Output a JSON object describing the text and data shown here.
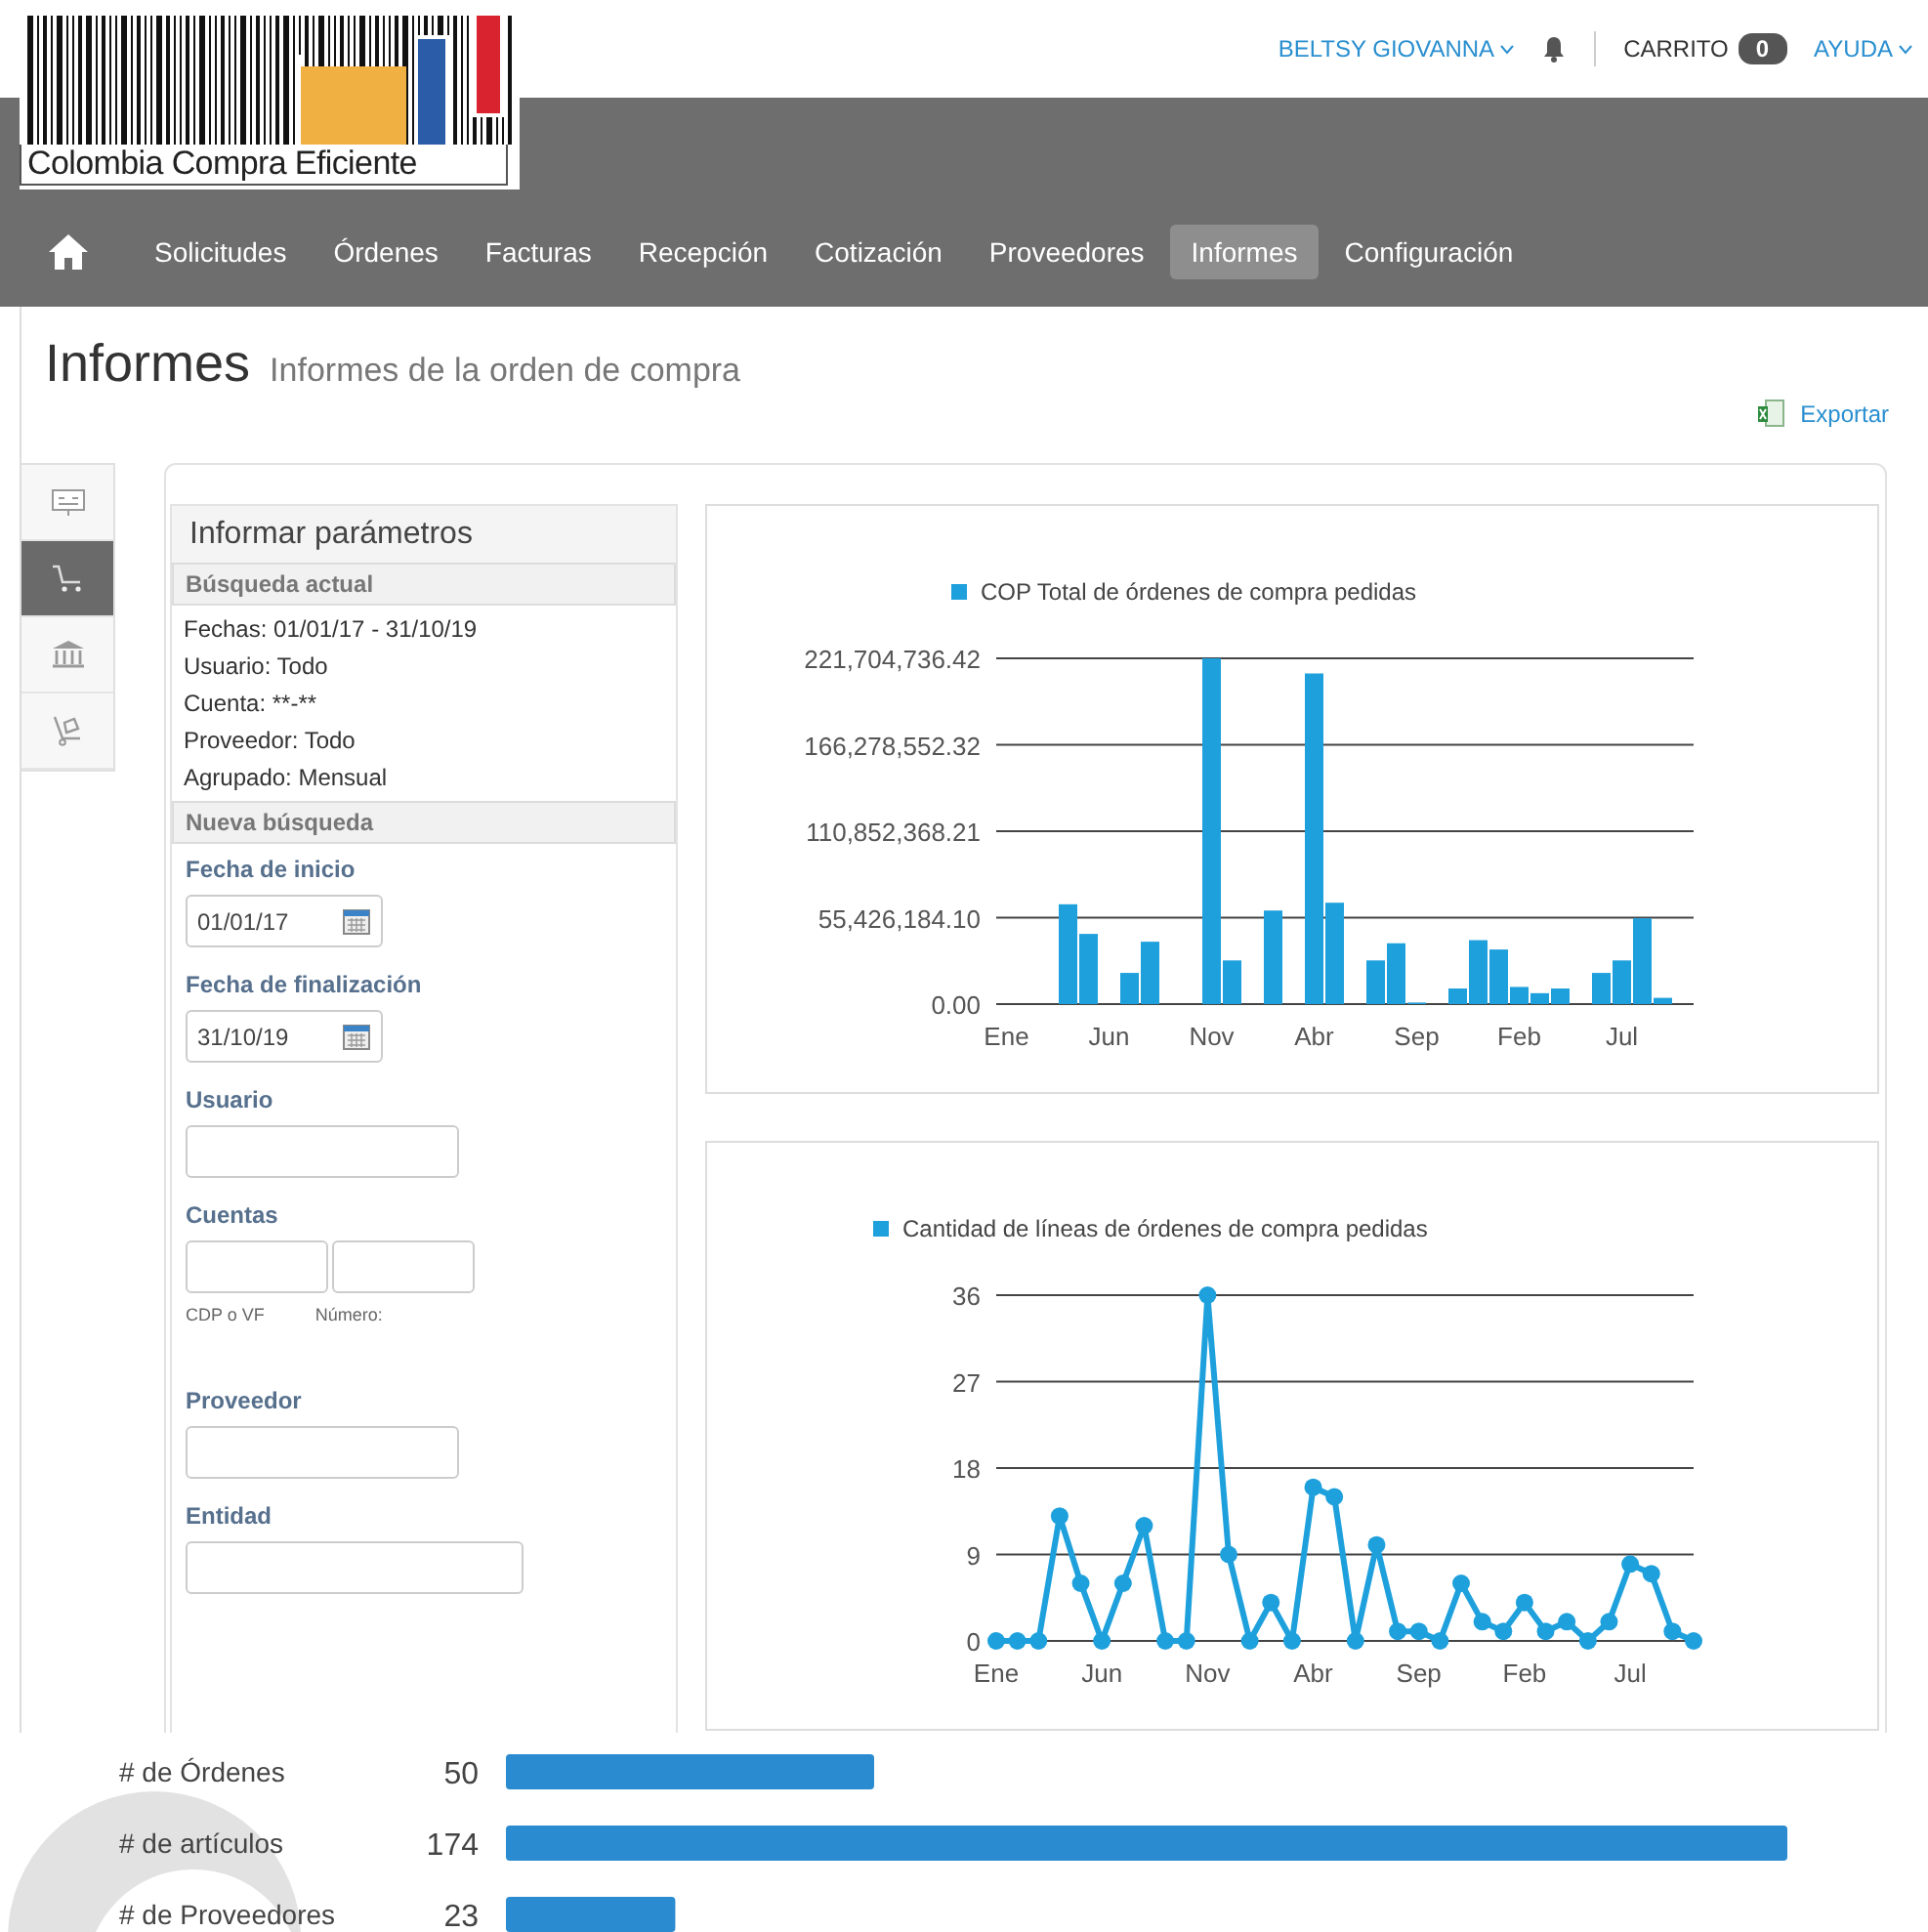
{
  "header": {
    "user": "BELTSY GIOVANNA",
    "cart_label": "CARRITO",
    "cart_count": "0",
    "help": "AYUDA"
  },
  "logo": {
    "text": "Colombia Compra Eficiente"
  },
  "nav": [
    {
      "label": "Solicitudes",
      "selected": false
    },
    {
      "label": "Órdenes",
      "selected": false
    },
    {
      "label": "Facturas",
      "selected": false
    },
    {
      "label": "Recepción",
      "selected": false
    },
    {
      "label": "Cotización",
      "selected": false
    },
    {
      "label": "Proveedores",
      "selected": false
    },
    {
      "label": "Informes",
      "selected": true
    },
    {
      "label": "Configuración",
      "selected": false
    }
  ],
  "page": {
    "title": "Informes",
    "subtitle": "Informes de la orden de compra",
    "export": "Exportar"
  },
  "side_tabs": [
    {
      "kind": "board",
      "selected": false
    },
    {
      "kind": "cart",
      "selected": true
    },
    {
      "kind": "bank",
      "selected": false
    },
    {
      "kind": "trolley",
      "selected": false
    }
  ],
  "params": {
    "title": "Informar parámetros",
    "current_heading": "Búsqueda actual",
    "current": [
      "Fechas: 01/01/17 - 31/10/19",
      "Usuario: Todo",
      "Cuenta: **-**",
      "Proveedor: Todo",
      "Agrupado: Mensual"
    ],
    "new_heading": "Nueva búsqueda",
    "fields": [
      {
        "kind": "date",
        "label": "Fecha de inicio",
        "value": "01/01/17"
      },
      {
        "kind": "date",
        "label": "Fecha de finalización",
        "value": "31/10/19"
      },
      {
        "kind": "text",
        "label": "Usuario"
      },
      {
        "kind": "pair",
        "label": "Cuentas",
        "captions": [
          "CDP o VF",
          "Número:"
        ]
      },
      {
        "kind": "text",
        "label": "Proveedor"
      },
      {
        "kind": "wide",
        "label": "Entidad"
      }
    ]
  },
  "charts": [
    {
      "chart_data": {
        "type": "bar",
        "categories": [
          "Ene",
          null,
          null,
          null,
          null,
          "Jun",
          null,
          null,
          null,
          null,
          "Nov",
          null,
          null,
          null,
          null,
          "Abr",
          null,
          null,
          null,
          null,
          "Sep",
          null,
          null,
          null,
          null,
          "Feb",
          null,
          null,
          null,
          null,
          "Jul",
          null,
          null,
          null
        ],
        "series": [
          {
            "name": "COP Total de órdenes de compra pedidas",
            "color": "#1ea0dc",
            "values": [
              0,
              0,
              0,
              64000000,
              45000000,
              0,
              20000000,
              40000000,
              0,
              0,
              221700000,
              28000000,
              0,
              60000000,
              0,
              212000000,
              65000000,
              0,
              28000000,
              39000000,
              1000000,
              0,
              10000000,
              41000000,
              35000000,
              11000000,
              7000000,
              10000000,
              0,
              20000000,
              28000000,
              55000000,
              4000000,
              0
            ]
          }
        ],
        "ylim": [
          0,
          221704736.42
        ],
        "grid": true,
        "yticks": [
          {
            "value": 0,
            "label": "0.00"
          },
          {
            "value": 55426184.1,
            "label": "55,426,184.10"
          },
          {
            "value": 110852368.21,
            "label": "110,852,368.21"
          },
          {
            "value": 166278552.32,
            "label": "166,278,552.32"
          },
          {
            "value": 221704736.42,
            "label": "221,704,736.42"
          }
        ]
      }
    },
    {
      "chart_data": {
        "type": "line",
        "categories": [
          "Ene",
          null,
          null,
          null,
          null,
          "Jun",
          null,
          null,
          null,
          null,
          "Nov",
          null,
          null,
          null,
          null,
          "Abr",
          null,
          null,
          null,
          null,
          "Sep",
          null,
          null,
          null,
          null,
          "Feb",
          null,
          null,
          null,
          null,
          "Jul",
          null,
          null,
          null
        ],
        "series": [
          {
            "name": "Cantidad de líneas de órdenes de compra pedidas",
            "color": "#1ea0dc",
            "values": [
              0,
              0,
              0,
              13,
              6,
              0,
              6,
              12,
              0,
              0,
              36,
              9,
              0,
              4,
              0,
              16,
              15,
              0,
              10,
              1,
              1,
              0,
              6,
              2,
              1,
              4,
              1,
              2,
              0,
              2,
              8,
              7,
              1,
              0
            ]
          }
        ],
        "ylim": [
          0,
          36
        ],
        "grid": true,
        "marker": "circle",
        "yticks": [
          0,
          9,
          18,
          27,
          36
        ]
      }
    }
  ],
  "summary": {
    "chart_data": {
      "type": "bar",
      "orientation": "horizontal",
      "categories": [
        "# de Órdenes",
        "# de artículos",
        "# de Proveedores"
      ],
      "values": [
        50,
        174,
        23
      ],
      "xlim": [
        0,
        174
      ],
      "data_labels": true
    }
  }
}
